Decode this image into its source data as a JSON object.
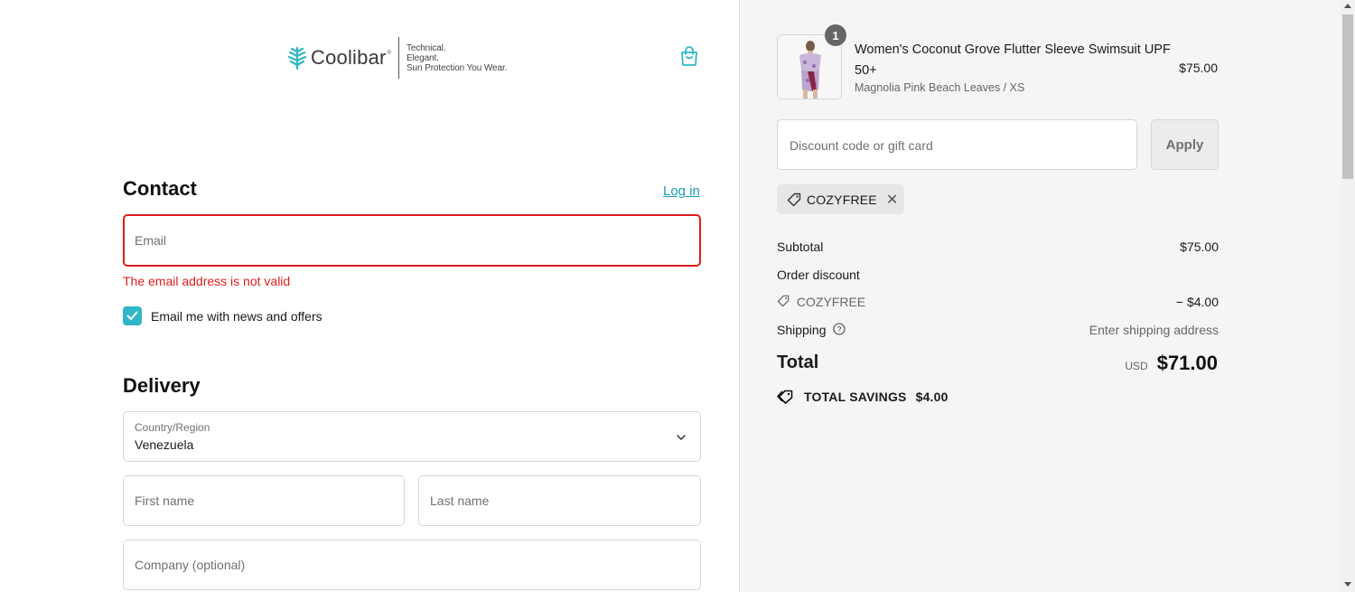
{
  "header": {
    "brand": "Coolibar",
    "brand_mark": "®",
    "tagline": [
      "Technical.",
      "Elegant.",
      "Sun Protection You Wear."
    ]
  },
  "contact": {
    "heading": "Contact",
    "login_link": "Log in",
    "email_placeholder": "Email",
    "email_error": "The email address is not valid",
    "newsletter_label": "Email me with news and offers",
    "newsletter_checked": true
  },
  "delivery": {
    "heading": "Delivery",
    "country_label": "Country/Region",
    "country_value": "Venezuela",
    "first_name_placeholder": "First name",
    "last_name_placeholder": "Last name",
    "company_placeholder": "Company (optional)"
  },
  "summary": {
    "item": {
      "quantity": "1",
      "name": "Women's Coconut Grove Flutter Sleeve Swimsuit UPF 50+",
      "variant": "Magnolia Pink Beach Leaves / XS",
      "price": "$75.00"
    },
    "discount_placeholder": "Discount code or gift card",
    "apply_label": "Apply",
    "applied_code": "COZYFREE",
    "subtotal_label": "Subtotal",
    "subtotal_value": "$75.00",
    "order_discount_label": "Order discount",
    "discount_code": "COZYFREE",
    "discount_value": "− $4.00",
    "shipping_label": "Shipping",
    "shipping_value": "Enter shipping address",
    "total_label": "Total",
    "total_currency": "USD",
    "total_value": "$71.00",
    "savings_label": "TOTAL SAVINGS",
    "savings_value": "$4.00"
  },
  "colors": {
    "accent": "#2fb7c6",
    "error": "#dd1d1d",
    "summary_bg": "#f5f5f5"
  },
  "icons": [
    "coolibar-leaf-logo",
    "shopping-bag-icon",
    "checkbox-check-icon",
    "chevron-down-icon",
    "tag-icon",
    "close-icon",
    "info-icon",
    "savings-tag-icon"
  ]
}
